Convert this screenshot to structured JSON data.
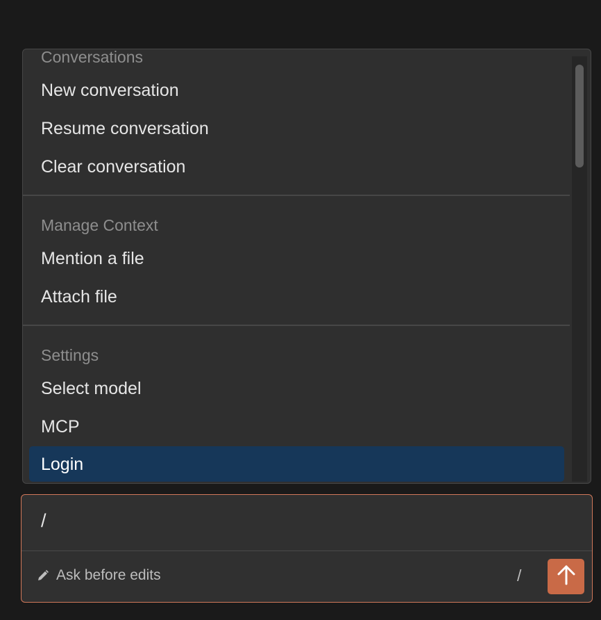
{
  "menu": {
    "sections": [
      {
        "header": "Conversations",
        "items": [
          "New conversation",
          "Resume conversation",
          "Clear conversation"
        ]
      },
      {
        "header": "Manage Context",
        "items": [
          "Mention a file",
          "Attach file"
        ]
      },
      {
        "header": "Settings",
        "items": [
          "Select model",
          "MCP",
          "Login"
        ]
      }
    ],
    "active_item": "Login"
  },
  "input": {
    "value": "/",
    "mode_label": "Ask before edits",
    "slash_hint": "/",
    "send_icon": "arrow-up-icon",
    "mode_icon": "pencil-icon"
  },
  "colors": {
    "accent": "#c96a47",
    "active_item_bg": "#163759"
  }
}
